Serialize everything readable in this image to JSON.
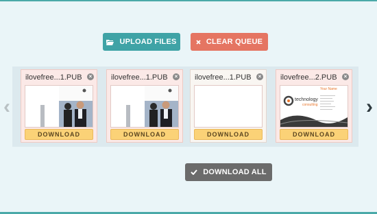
{
  "toolbar": {
    "upload_label": "UPLOAD FILES",
    "clear_label": "CLEAR QUEUE",
    "download_all_label": "DOWNLOAD ALL"
  },
  "files": [
    {
      "name": "ilovefree...1.PUB",
      "download_label": "DOWNLOAD",
      "preview": "brochure"
    },
    {
      "name": "ilovefree...1.PUB",
      "download_label": "DOWNLOAD",
      "preview": "brochure"
    },
    {
      "name": "ilovefree...1.PUB",
      "download_label": "DOWNLOAD",
      "preview": "blank"
    },
    {
      "name": "ilovefree...2.PUB",
      "download_label": "DOWNLOAD",
      "preview": "business-card"
    }
  ],
  "card_preview": {
    "logo_text": "technology",
    "logo_subtext": "consulting",
    "name_line": "Your Name"
  },
  "colors": {
    "accent_teal": "#3fa3a6",
    "danger_coral": "#e57562",
    "neutral_gray": "#6b6b6b",
    "download_yellow": "#fbd277"
  }
}
